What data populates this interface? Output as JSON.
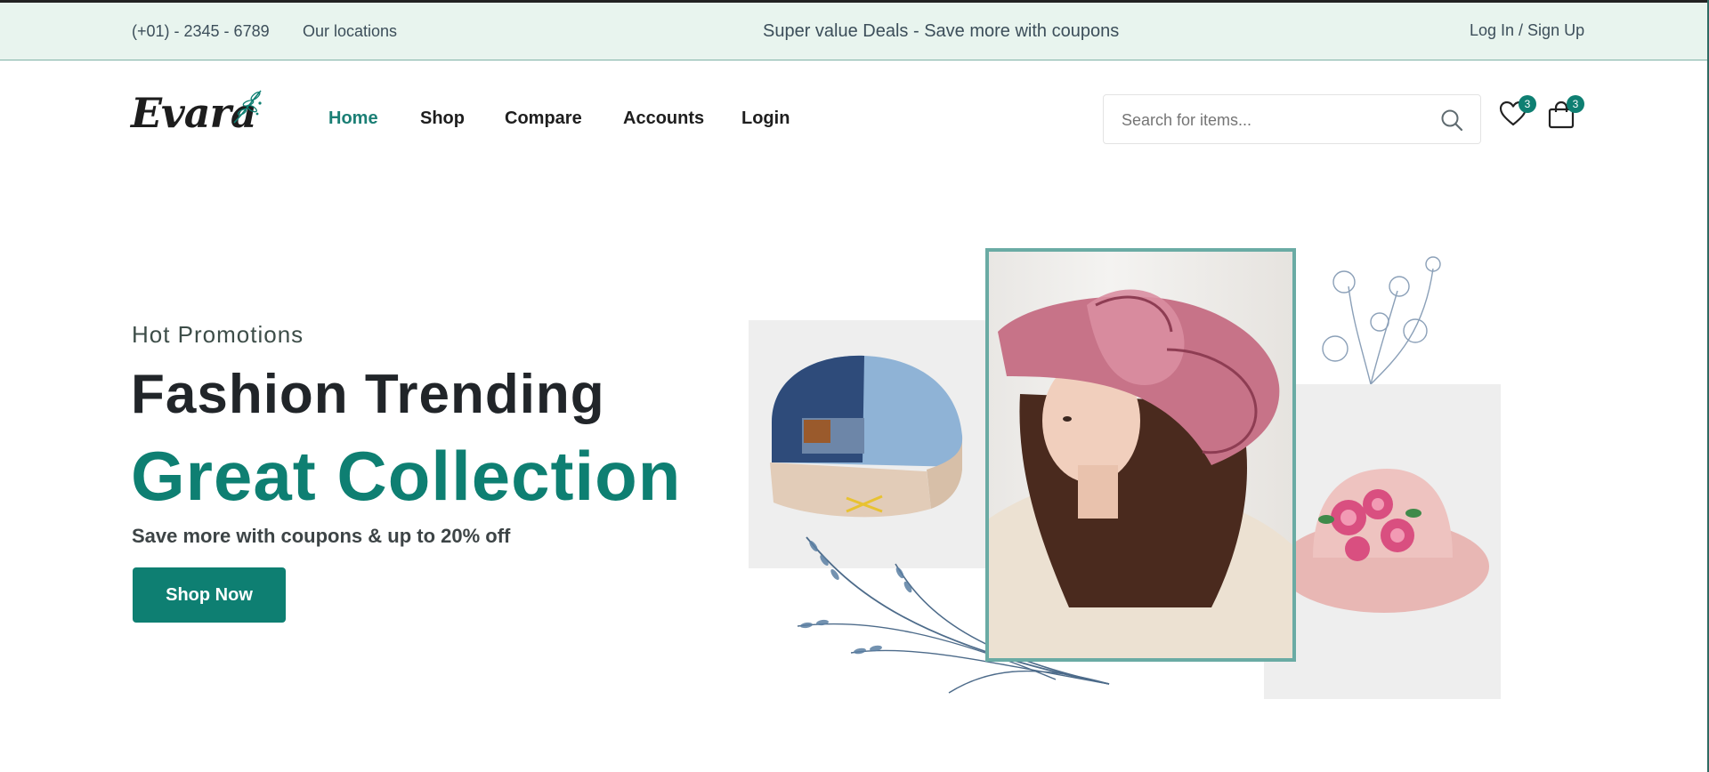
{
  "topbar": {
    "phone": "(+01) - 2345 - 6789",
    "locations": "Our locations",
    "promo": "Super value Deals - Save more with coupons",
    "auth": "Log In / Sign Up"
  },
  "header": {
    "logo": "Evara",
    "nav": [
      {
        "label": "Home",
        "active": true
      },
      {
        "label": "Shop",
        "active": false
      },
      {
        "label": "Compare",
        "active": false
      },
      {
        "label": "Accounts",
        "active": false
      },
      {
        "label": "Login",
        "active": false
      }
    ],
    "search": {
      "placeholder": "Search for items...",
      "icon": "search-icon"
    },
    "wishlist": {
      "icon": "heart-icon",
      "count": "3"
    },
    "cart": {
      "icon": "bag-icon",
      "count": "3"
    }
  },
  "hero": {
    "subtitle": "Hot Promotions",
    "title_line1": "Fashion Trending",
    "title_line2": "Great Collection",
    "description": "Save more with coupons & up to 20% off",
    "cta": "Shop Now"
  },
  "colors": {
    "accent": "#0e7f72",
    "topbar_bg": "#e8f4ee",
    "text_dark": "#212529"
  }
}
